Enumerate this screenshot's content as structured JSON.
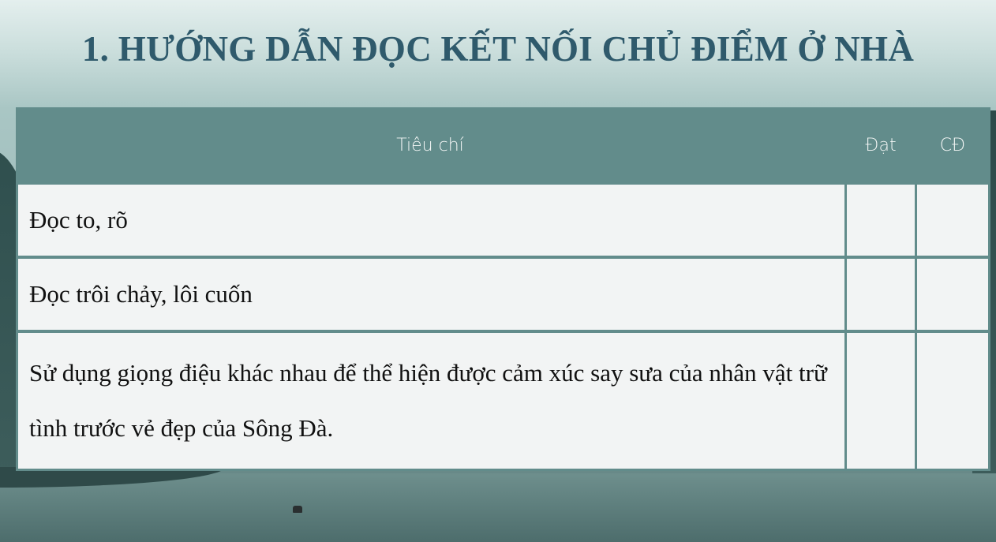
{
  "title": "1. HƯỚNG DẪN ĐỌC KẾT NỐI CHỦ ĐIỂM Ở NHÀ",
  "table": {
    "headers": {
      "criteria": "Tiêu chí",
      "pass": "Đạt",
      "fail": "CĐ"
    },
    "rows": [
      {
        "criteria": "Đọc to, rõ",
        "pass": "",
        "fail": ""
      },
      {
        "criteria": "Đọc trôi chảy, lôi cuốn",
        "pass": "",
        "fail": ""
      },
      {
        "criteria": "Sử dụng giọng điệu khác nhau để thể hiện được cảm xúc say sưa của nhân vật trữ tình trước vẻ đẹp của Sông Đà.",
        "pass": "",
        "fail": ""
      }
    ]
  },
  "colors": {
    "title": "#2f5a6c",
    "table_header": "#628c8b",
    "table_cell": "#f2f4f4"
  }
}
